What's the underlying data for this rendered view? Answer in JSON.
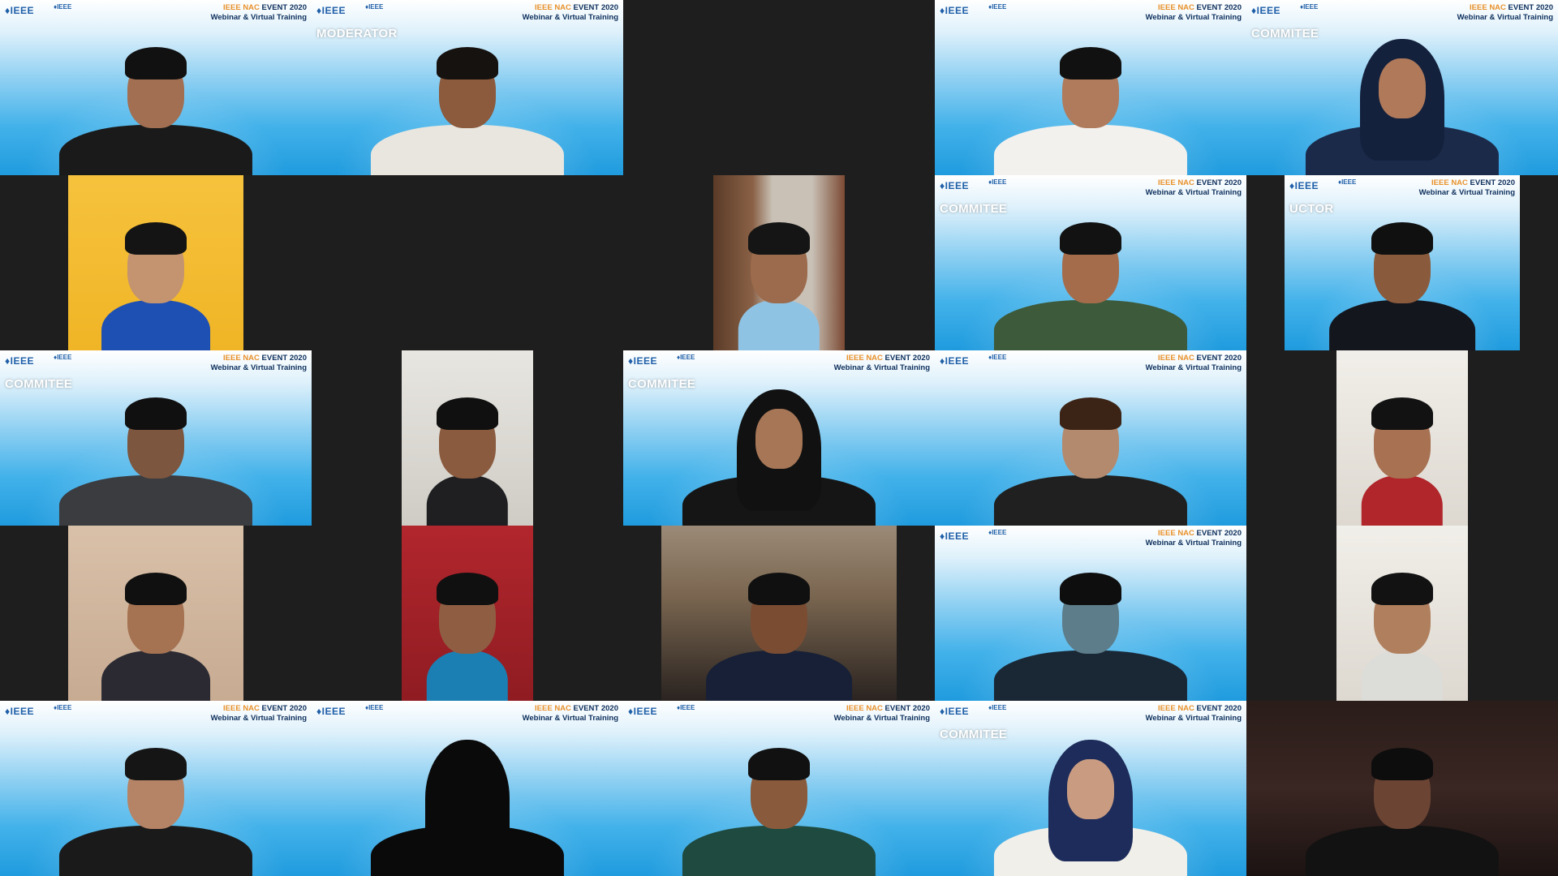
{
  "meeting": {
    "layout": "gallery-view",
    "columns": 5,
    "rows": 5
  },
  "branding": {
    "ieee_logo": "♦IEEE",
    "ieee_logo_secondary": "♦IEEE",
    "event_line1_highlight": "IEEE NAC",
    "event_line1_rest": "EVENT 2020",
    "event_line2": "Webinar & Virtual Training"
  },
  "colors": {
    "meeting_background": "#1e1e1e",
    "ieee_blue": "#1f9bde",
    "event_highlight": "#e8912b",
    "role_label": "#ffffff"
  },
  "tiles": [
    {
      "id": 1,
      "background": "ieee",
      "frame": "full",
      "role": "",
      "skin": "#a26f52",
      "shirt": "#1a1a1a",
      "hair": "#111111",
      "hijab": ""
    },
    {
      "id": 2,
      "background": "ieee",
      "frame": "full",
      "role": "MODERATOR",
      "skin": "#8c5a3c",
      "shirt": "#e9e6df",
      "hair": "#161210",
      "hijab": ""
    },
    {
      "id": 3,
      "background": "none",
      "frame": "blank",
      "role": "",
      "skin": "",
      "shirt": "",
      "hair": "",
      "hijab": ""
    },
    {
      "id": 4,
      "background": "ieee",
      "frame": "full",
      "role": "",
      "skin": "#b07b5c",
      "shirt": "#f3f1ee",
      "hair": "#111111",
      "hijab": ""
    },
    {
      "id": 5,
      "background": "ieee",
      "frame": "full",
      "role": "COMMITEE",
      "skin": "#b07a5a",
      "shirt": "#1c2a4a",
      "hair": "",
      "hijab": "#14213d"
    },
    {
      "id": 6,
      "background": "yellow",
      "frame": "portrait",
      "role": "",
      "skin": "#c4936f",
      "shirt": "#1e4fb3",
      "hair": "#141414",
      "hijab": ""
    },
    {
      "id": 7,
      "background": "none",
      "frame": "blank",
      "role": "",
      "skin": "",
      "shirt": "",
      "hair": "",
      "hijab": ""
    },
    {
      "id": 8,
      "background": "bookshelf",
      "frame": "narrow",
      "role": "",
      "skin": "#9c6a4c",
      "shirt": "#8fc3e4",
      "hair": "#151515",
      "hijab": ""
    },
    {
      "id": 9,
      "background": "ieee",
      "frame": "full",
      "role": "COMMITEE",
      "skin": "#a56c4c",
      "shirt": "#3d5a3a",
      "hair": "#121212",
      "hijab": ""
    },
    {
      "id": 10,
      "background": "ieee",
      "frame": "wide",
      "role": "UCTOR",
      "skin": "#8a5a3c",
      "shirt": "#14161d",
      "hair": "#101010",
      "hijab": ""
    },
    {
      "id": 11,
      "background": "ieee",
      "frame": "full",
      "role": "COMMITEE",
      "skin": "#7d563f",
      "shirt": "#3a3c40",
      "hair": "#101010",
      "hijab": ""
    },
    {
      "id": 12,
      "background": "wall",
      "frame": "narrow",
      "role": "",
      "skin": "#8a5b3e",
      "shirt": "#1f1f22",
      "hair": "#101010",
      "hijab": ""
    },
    {
      "id": 13,
      "background": "ieee",
      "frame": "full",
      "role": "COMMITEE",
      "skin": "#a77656",
      "shirt": "#151515",
      "hair": "",
      "hijab": "#111111"
    },
    {
      "id": 14,
      "background": "ieee",
      "frame": "full",
      "role": "",
      "skin": "#b48a6e",
      "shirt": "#202020",
      "hair": "#3b2416",
      "hijab": ""
    },
    {
      "id": 15,
      "background": "plain",
      "frame": "narrow",
      "role": "",
      "skin": "#a77152",
      "shirt": "#b0262b",
      "hair": "#121212",
      "hijab": ""
    },
    {
      "id": 16,
      "background": "beige",
      "frame": "portrait",
      "role": "",
      "skin": "#a57252",
      "shirt": "#2b2a33",
      "hair": "#101010",
      "hijab": ""
    },
    {
      "id": 17,
      "background": "red",
      "frame": "narrow",
      "role": "",
      "skin": "#8f5e42",
      "shirt": "#1b7fb3",
      "hair": "#101010",
      "hijab": ""
    },
    {
      "id": 18,
      "background": "wood",
      "frame": "wide",
      "role": "",
      "skin": "#7a4d33",
      "shirt": "#172036",
      "hair": "#101010",
      "hijab": ""
    },
    {
      "id": 19,
      "background": "ieee",
      "frame": "full",
      "role": "",
      "skin": "#5d7d8a",
      "shirt": "#1a2836",
      "hair": "#0e0e0e",
      "hijab": ""
    },
    {
      "id": 20,
      "background": "plain",
      "frame": "narrow",
      "role": "",
      "skin": "#b0805e",
      "shirt": "#dcdcd8",
      "hair": "#121212",
      "hijab": ""
    },
    {
      "id": 21,
      "background": "ieee",
      "frame": "full",
      "role": "",
      "skin": "#b58466",
      "shirt": "#1a1a1a",
      "hair": "#151515",
      "hijab": ""
    },
    {
      "id": 22,
      "background": "ieee",
      "frame": "full",
      "role": "",
      "skin": "#0a0a0a",
      "shirt": "#0a0a0a",
      "hair": "",
      "hijab": "#0a0a0a"
    },
    {
      "id": 23,
      "background": "ieee",
      "frame": "full",
      "role": "",
      "skin": "#8a5a3c",
      "shirt": "#1e4a40",
      "hair": "#111111",
      "hijab": ""
    },
    {
      "id": 24,
      "background": "ieee",
      "frame": "full",
      "role": "COMMITEE",
      "skin": "#c99c82",
      "shirt": "#f1efe9",
      "hair": "",
      "hijab": "#1d2c5a"
    },
    {
      "id": 25,
      "background": "dark",
      "frame": "full",
      "role": "",
      "skin": "#6b4433",
      "shirt": "#121212",
      "hair": "#0d0d0d",
      "hijab": ""
    }
  ]
}
